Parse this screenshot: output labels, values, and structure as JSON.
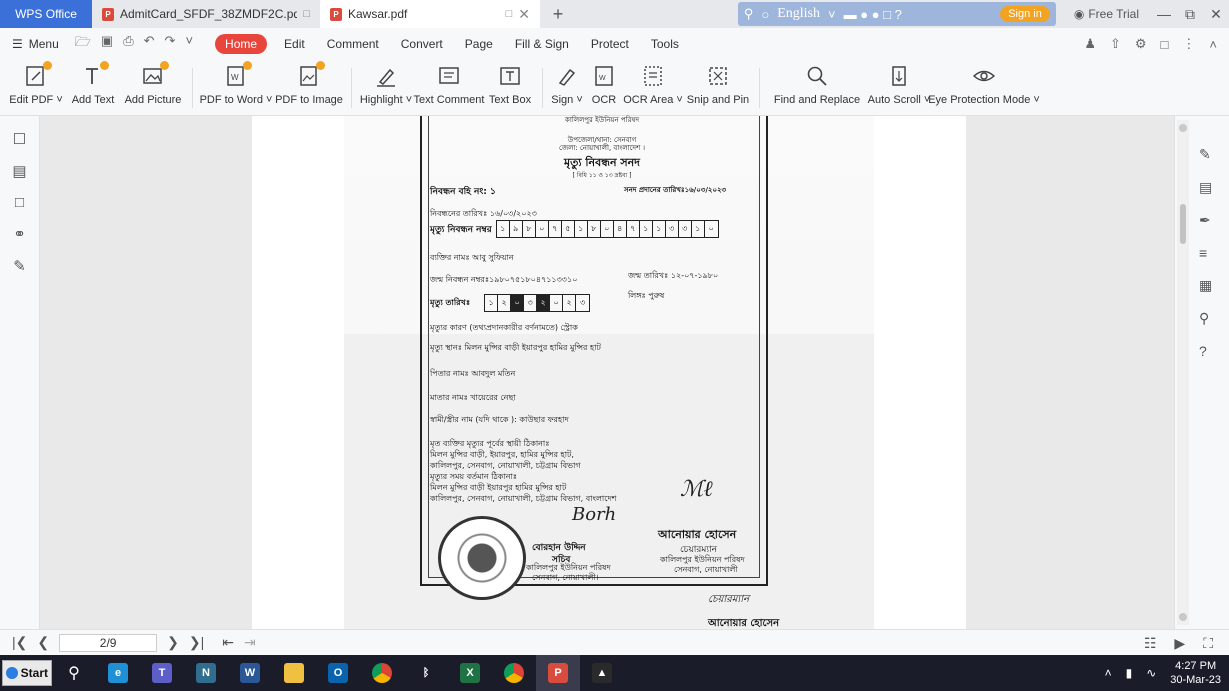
{
  "titlebar": {
    "app_tab": "WPS Office",
    "tabs": [
      {
        "label": "AdmitCard_SFDF_38ZMDF2C.pdf",
        "active": false
      },
      {
        "label": "Kawsar.pdf",
        "active": true
      }
    ],
    "language": "English",
    "sign_in": "Sign in",
    "free_trial": "Free Trial"
  },
  "menubar": {
    "menu_label": "Menu",
    "items": [
      "Home",
      "Edit",
      "Comment",
      "Convert",
      "Page",
      "Fill & Sign",
      "Protect",
      "Tools"
    ],
    "active": "Home"
  },
  "ribbon": {
    "tools": [
      {
        "label": "Edit PDF ˅",
        "icon": "edit-pdf-icon"
      },
      {
        "label": "Add Text",
        "icon": "add-text-icon"
      },
      {
        "label": "Add Picture",
        "icon": "add-picture-icon"
      },
      {
        "label": "PDF to Word ˅",
        "icon": "pdf-to-word-icon"
      },
      {
        "label": "PDF to Image",
        "icon": "pdf-to-image-icon"
      },
      {
        "label": "Highlight ˅",
        "icon": "highlight-icon"
      },
      {
        "label": "Text Comment",
        "icon": "text-comment-icon"
      },
      {
        "label": "Text Box",
        "icon": "text-box-icon"
      },
      {
        "label": "Sign ˅",
        "icon": "sign-icon"
      },
      {
        "label": "OCR",
        "icon": "ocr-icon"
      },
      {
        "label": "OCR Area ˅",
        "icon": "ocr-area-icon"
      },
      {
        "label": "Snip and Pin",
        "icon": "snip-and-pin-icon"
      },
      {
        "label": "Find and Replace",
        "icon": "find-and-replace-icon"
      },
      {
        "label": "Auto Scroll ˅",
        "icon": "auto-scroll-icon"
      },
      {
        "label": "Eye Protection Mode ˅",
        "icon": "eye-protection-icon"
      }
    ]
  },
  "document": {
    "council": "কালিলপুর ইউনিয়ন পরিষদ",
    "upazila": "উপজেলা/থানা: সেনবাগ",
    "district": "জেলা: নোয়াখালী, বাংলাদেশ ।",
    "title": "মৃত্যু নিবন্ধন সনদ",
    "rule": "[ বিধি ১১ ও ১৩ দ্রষ্টব্য ]",
    "book_no": "নিবন্ধন বহি নং: ১",
    "issue_date": "সনদ প্রদানের তারিখঃ১৬/০৩/২০২৩",
    "reg_date": "নিবন্ধনের তারিখঃ ১৬/০৩/২০২৩",
    "death_reg_label": "মৃত্যু নিবন্ধন নম্বর",
    "death_reg_digits": [
      "১",
      "৯",
      "৮",
      "০",
      "৭",
      "৫",
      "১",
      "৮",
      "০",
      "৪",
      "৭",
      "১",
      "১",
      "৩",
      "৩",
      "১",
      "০"
    ],
    "person_name": "ব্যক্তির নামঃ  আবু সুফিয়ান",
    "birth_reg": "জন্ম নিবন্ধন নম্বরঃ১৯৮০৭৫১৮০৪৭১১৩৩১০",
    "birth_date": "জন্ম তারিখঃ  ১২-০৭-১৯৮০",
    "death_date_label": "মৃত্যু তারিখঃ",
    "death_date_digits": [
      "১",
      "২",
      "০",
      "৩",
      "২",
      "০",
      "২",
      "৩"
    ],
    "sex": "লিঙ্গঃ পুরুষ",
    "cause": "মৃত্যুর কারণ (তথ্যপ্রদানকারীর বর্ণনামতে) স্ট্রোক",
    "place": "মৃত্যু স্থানঃ   মিলন মুন্সির বাড়ী ইয়ারপুর হামির মুন্সির হাট",
    "father": "পিতার নামঃ   আবদুল মতিন",
    "mother": "মাতার নামঃ   খায়েরের নেছা",
    "spouse": "স্বামী/স্ত্রীর নাম (যদি থাকে ): কাউছার ফরহাদ",
    "perm_addr_label": "মৃত ব্যক্তির মৃত্যুর পূর্বের স্থায়ী ঠিকানাঃ",
    "perm_addr_1": "মিলন মুন্সির বাড়ী, ইয়ারপুর, হামির মুন্সির হাট,",
    "perm_addr_2": "কালিলপুর, সেনবাগ, নোয়াখালী, চট্টগ্রাম বিভাগ",
    "curr_addr_label": "মৃত্যুর সময় বর্তমান ঠিকানাঃ",
    "curr_addr_1": "মিলন মুন্সির বাড়ী ইয়ারপুর হামির মুন্সির হাট",
    "curr_addr_2": "কালিলপুর, সেনবাগ, নোয়াখালী, চট্টগ্রাম বিভাগ, বাংলাদেশ",
    "secretary_name": "বোরহান উদ্দিন",
    "secretary_title": "সচিব",
    "chairman_name": "আনোয়ার হোসেন",
    "chairman_title": "চেয়ারম্যান",
    "chairman_council": "কালিলপুর ইউনিয়ন পরিষদ",
    "chairman_place": "সেনবাগ, নোয়াখালী",
    "secretary_council": "কালিলপুর ইউনিয়ন পরিষদ",
    "secretary_place": "সেনবাগ, নোয়াখালী।",
    "signature_bottom": "চেয়ারম্যান",
    "signature_bottom_2": "আনোয়ার হোসেন"
  },
  "statusbar": {
    "page_indicator": "2/9"
  },
  "taskbar": {
    "start_label": "Start",
    "time": "4:27 PM",
    "date": "30-Mar-23",
    "apps": [
      {
        "name": "edge",
        "color": "#1f8fd6",
        "glyph": "e"
      },
      {
        "name": "teams",
        "color": "#5b5fc7",
        "glyph": "T"
      },
      {
        "name": "onenote-n",
        "color": "#2f6e8f",
        "glyph": "N"
      },
      {
        "name": "word",
        "color": "#2b5797",
        "glyph": "W"
      },
      {
        "name": "file-explorer",
        "color": "#f0c040",
        "glyph": ""
      },
      {
        "name": "outlook",
        "color": "#0a64ad",
        "glyph": "O"
      },
      {
        "name": "chrome",
        "color": "#db4437",
        "glyph": ""
      },
      {
        "name": "bluetooth",
        "color": "#1b1c2a",
        "glyph": "ᛒ"
      },
      {
        "name": "excel",
        "color": "#1f7244",
        "glyph": "X"
      },
      {
        "name": "chrome-2",
        "color": "#db4437",
        "glyph": ""
      },
      {
        "name": "wps-pdf",
        "color": "#d94b3c",
        "glyph": "P"
      },
      {
        "name": "photos",
        "color": "#2a2a2a",
        "glyph": "▲"
      }
    ]
  }
}
